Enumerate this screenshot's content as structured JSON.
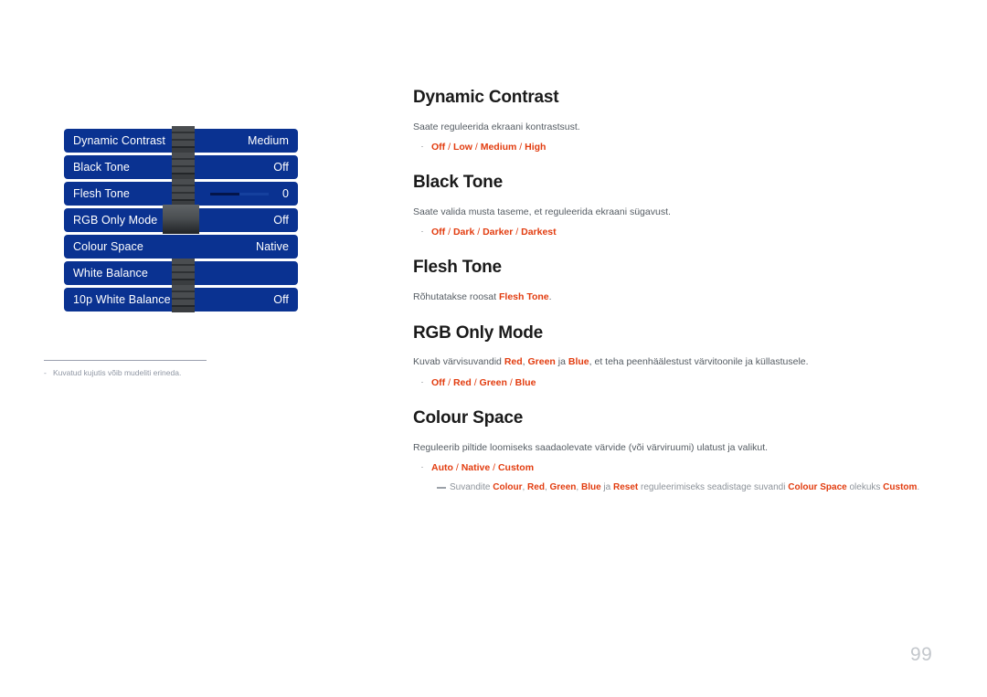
{
  "osd": {
    "rows": [
      {
        "label": "Dynamic Contrast",
        "value": "Medium",
        "knob": "ribbed",
        "slider": false
      },
      {
        "label": "Black Tone",
        "value": "Off",
        "knob": "ribbed",
        "slider": false
      },
      {
        "label": "Flesh Tone",
        "value": "0",
        "knob": "ribbed",
        "slider": true
      },
      {
        "label": "RGB Only Mode",
        "value": "Off",
        "knob": "wide",
        "slider": false
      },
      {
        "label": "Colour Space",
        "value": "Native",
        "knob": "none",
        "slider": false
      },
      {
        "label": "White Balance",
        "value": "",
        "knob": "ribbed",
        "slider": false
      },
      {
        "label": "10p White Balance",
        "value": "Off",
        "knob": "ribbed",
        "slider": false
      }
    ],
    "note": "Kuvatud kujutis võib mudeliti erineda.",
    "note_dash": "-",
    "panel_color": "#0a3291"
  },
  "content": {
    "sections": [
      {
        "title": "Dynamic Contrast",
        "desc": "Saate reguleerida ekraani kontrastsust.",
        "bullet_dot": "·",
        "options": [
          "Off",
          "Low",
          "Medium",
          "High"
        ]
      },
      {
        "title": "Black Tone",
        "desc": "Saate valida musta taseme, et reguleerida ekraani sügavust.",
        "bullet_dot": "·",
        "options": [
          "Off",
          "Dark",
          "Darker",
          "Darkest"
        ]
      },
      {
        "title": "Flesh Tone",
        "desc_parts": [
          {
            "t": "Rõhutatakse roosat ",
            "em": false
          },
          {
            "t": "Flesh Tone",
            "em": true
          },
          {
            "t": ".",
            "em": false
          }
        ]
      },
      {
        "title": "RGB Only Mode",
        "desc_parts": [
          {
            "t": "Kuvab värvisuvandid ",
            "em": false
          },
          {
            "t": "Red",
            "em": true
          },
          {
            "t": ", ",
            "em": false
          },
          {
            "t": "Green",
            "em": true
          },
          {
            "t": " ja ",
            "em": false
          },
          {
            "t": "Blue",
            "em": true
          },
          {
            "t": ", et teha peenhäälestust värvitoonile ja küllastusele.",
            "em": false
          }
        ],
        "bullet_dot": "·",
        "options": [
          "Off",
          "Red",
          "Green",
          "Blue"
        ]
      },
      {
        "title": "Colour Space",
        "desc": "Reguleerib piltide loomiseks saadaolevate värvide (või värviruumi) ulatust ja valikut.",
        "bullet_dot": "·",
        "options": [
          "Auto",
          "Native",
          "Custom"
        ],
        "sub_note_parts": [
          {
            "t": "Suvandite ",
            "em": false
          },
          {
            "t": "Colour",
            "em": true
          },
          {
            "t": ", ",
            "em": false
          },
          {
            "t": "Red",
            "em": true
          },
          {
            "t": ", ",
            "em": false
          },
          {
            "t": "Green",
            "em": true
          },
          {
            "t": ", ",
            "em": false
          },
          {
            "t": "Blue",
            "em": true
          },
          {
            "t": " ja ",
            "em": false
          },
          {
            "t": "Reset",
            "em": true
          },
          {
            "t": " reguleerimiseks seadistage suvandi ",
            "em": false
          },
          {
            "t": "Colour Space",
            "em": true
          },
          {
            "t": " olekuks ",
            "em": false
          },
          {
            "t": "Custom",
            "em": true
          },
          {
            "t": ".",
            "em": false
          }
        ]
      }
    ],
    "option_separator": " / ",
    "accent_color": "#e23c0f"
  },
  "page_number": "99"
}
